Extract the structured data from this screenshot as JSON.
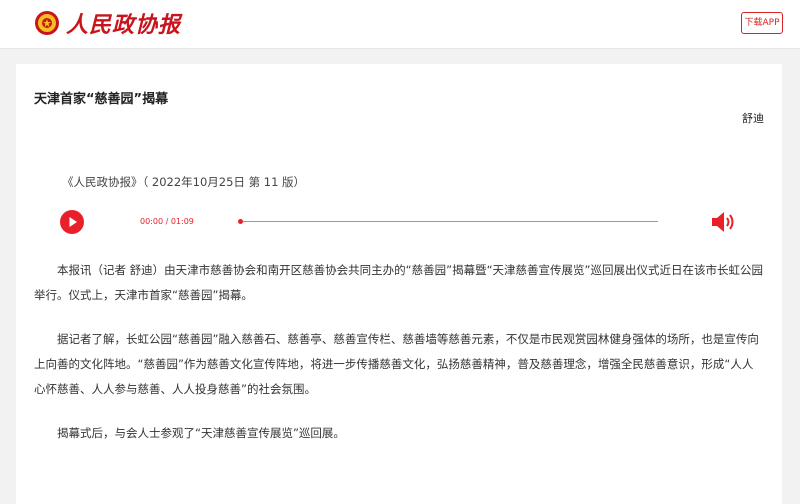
{
  "header": {
    "logo_text": "人民政协报",
    "download_label": "下载APP"
  },
  "article": {
    "title": "天津首家“慈善园”揭幕",
    "author": "舒迪",
    "source": "《人民政协报》（ 2022年10月25日 第 11 版）",
    "paragraphs": [
      "本报讯（记者 舒迪）由天津市慈善协会和南开区慈善协会共同主办的“慈善园”揭幕暨“天津慈善宣传展览”巡回展出仪式近日在该市长虹公园举行。仪式上，天津市首家“慈善园”揭幕。",
      "据记者了解，长虹公园“慈善园”融入慈善石、慈善亭、慈善宣传栏、慈善墙等慈善元素，不仅是市民观赏园林健身强体的场所，也是宣传向上向善的文化阵地。“慈善园”作为慈善文化宣传阵地，将进一步传播慈善文化，弘扬慈善精神，普及慈善理念，增强全民慈善意识，形成“人人心怀慈善、人人参与慈善、人人投身慈善”的社会氛围。",
      "揭幕式后，与会人士参观了“天津慈善宣传展览”巡回展。"
    ]
  },
  "player": {
    "time": "00:00 / 01:09",
    "progress": 0,
    "accent_color": "#e8202a"
  },
  "icons": {
    "logo": "cppcc-emblem-icon",
    "play": "play-icon",
    "volume": "speaker-icon"
  }
}
